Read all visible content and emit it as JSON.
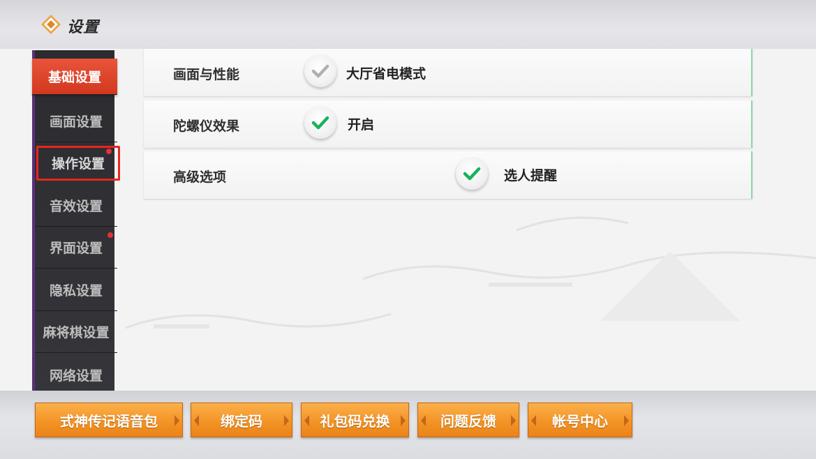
{
  "header": {
    "title": "设置",
    "logo_icon": "diamond-logo-icon"
  },
  "sidebar": {
    "items": [
      {
        "label": "基础设置",
        "active": true,
        "dot": false
      },
      {
        "label": "画面设置",
        "active": false,
        "dot": false
      },
      {
        "label": "操作设置",
        "active": false,
        "dot": true,
        "highlighted": true
      },
      {
        "label": "音效设置",
        "active": false,
        "dot": false
      },
      {
        "label": "界面设置",
        "active": false,
        "dot": true
      },
      {
        "label": "隐私设置",
        "active": false,
        "dot": false
      },
      {
        "label": "麻将棋设置",
        "active": false,
        "dot": false
      },
      {
        "label": "网络设置",
        "active": false,
        "dot": false
      }
    ]
  },
  "options": [
    {
      "label": "画面与性能",
      "check_label": "大厅省电模式",
      "checked": false
    },
    {
      "label": "陀螺仪效果",
      "check_label": "开启",
      "checked": true
    },
    {
      "label": "高级选项",
      "check_label": "选人提醒",
      "checked": true
    }
  ],
  "bottom_buttons": [
    {
      "label": "式神传记语音包"
    },
    {
      "label": "绑定码"
    },
    {
      "label": "礼包码兑换"
    },
    {
      "label": "问题反馈"
    },
    {
      "label": "帐号中心"
    }
  ],
  "colors": {
    "active_tab": "#d2381f",
    "check_on": "#18b35a",
    "check_off": "#b0b0b0",
    "button_orange": "#f39426",
    "highlight_outline": "#e8261c"
  }
}
